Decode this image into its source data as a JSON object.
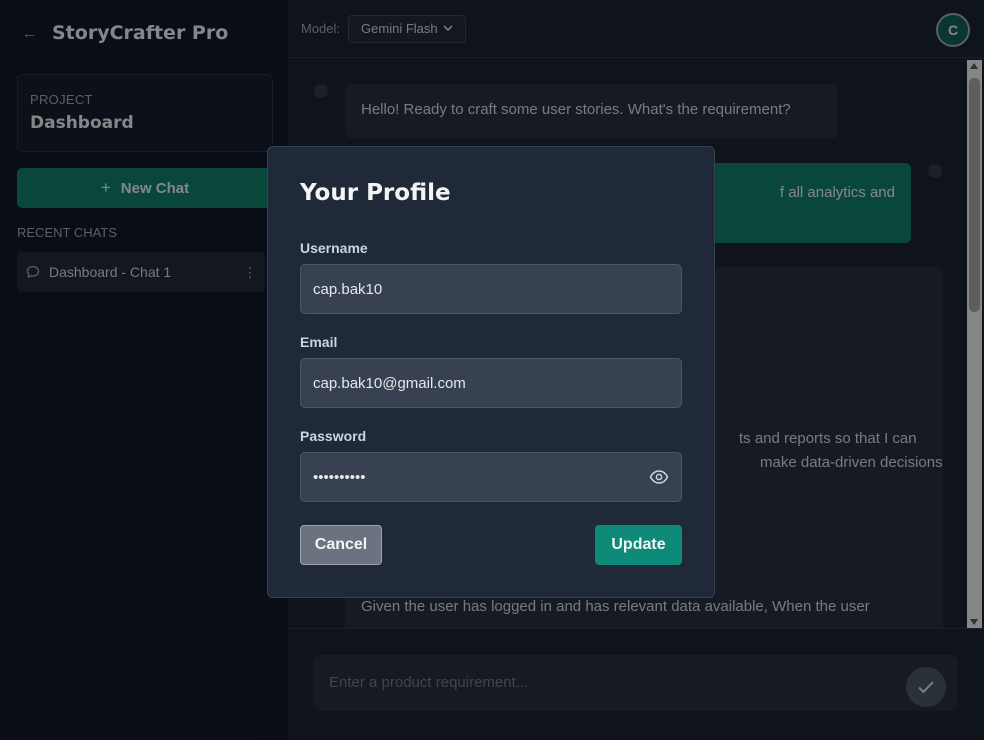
{
  "sidebar": {
    "app_title": "StoryCrafter Pro",
    "back_icon": "arrow-left",
    "project_label": "PROJECT",
    "project_name": "Dashboard",
    "new_chat_label": "New Chat",
    "new_chat_icon": "+",
    "recent_heading": "RECENT CHATS",
    "recent_chats": [
      {
        "label": "Dashboard - Chat 1",
        "icon": "chat-bubble"
      }
    ]
  },
  "header": {
    "model_label": "Model:",
    "model_selected": "Gemini Flash",
    "avatar_initial": "C"
  },
  "chat": {
    "messages": [
      {
        "role": "assistant",
        "text": "Hello! Ready to craft some user stories. What's the requirement?"
      },
      {
        "role": "user",
        "visible_text": "f all analytics and"
      },
      {
        "role": "assistant",
        "visible_lines": [
          "ts and reports so that I can",
          "make data-driven decisions.",
          "Given the user has logged in and has relevant data available, When the user"
        ]
      }
    ],
    "composer_placeholder": "Enter a product requirement..."
  },
  "profile_modal": {
    "title": "Your Profile",
    "username_label": "Username",
    "username_value": "cap.bak10",
    "email_label": "Email",
    "email_value": "cap.bak10@gmail.com",
    "password_label": "Password",
    "password_masked": "••••••••••",
    "cancel_label": "Cancel",
    "update_label": "Update"
  },
  "colors": {
    "accent": "#117a67",
    "update_button": "#0f8a78",
    "background": "#111827",
    "panel": "#1f2937"
  }
}
